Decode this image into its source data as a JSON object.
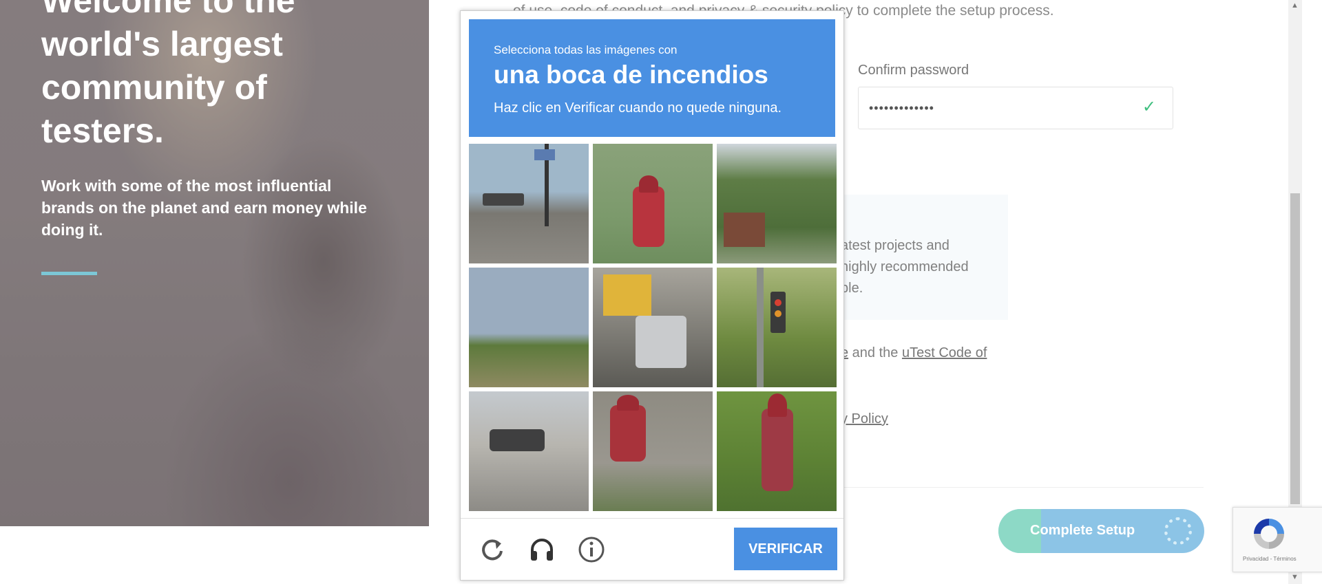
{
  "hero": {
    "headline": "Welcome to the world's largest community of testers.",
    "subtext": "Work with some of the most influential brands on the planet and earn money while doing it."
  },
  "form": {
    "top_line": "of use, code of conduct, and privacy & security policy to complete the setup process.",
    "confirm_password_label": "Confirm password",
    "confirm_password_value": "•••••••••••••",
    "newsletter_lines": [
      "atest projects and",
      "highly recommended",
      "ble."
    ],
    "agree_line_prefix": "e",
    "agree_line_middle": " and the ",
    "agree_line_link": "uTest Code of",
    "policy_line": "y Policy",
    "complete_button": "Complete Setup"
  },
  "captcha": {
    "instruction_small": "Selecciona todas las imágenes con",
    "instruction_target": "una boca de incendios",
    "instruction_hint": "Haz clic en Verificar cuando no quede ninguna.",
    "verify_button": "VERIFICAR",
    "tiles": [
      "street-intersection",
      "fire-hydrant",
      "trees-house",
      "empty-field",
      "traffic-bus-cars",
      "traffic-light",
      "intersection-car",
      "fire-hydrant-sidewalk",
      "fire-hydrant-grass"
    ],
    "icons": [
      "refresh-icon",
      "headphones-icon",
      "info-icon"
    ]
  },
  "recaptcha_badge": {
    "terms": "Privacidad - Términos"
  },
  "colors": {
    "captcha_blue": "#4a90e2",
    "success_green": "#3fbf7f",
    "accent_teal": "#7cc7d6"
  }
}
